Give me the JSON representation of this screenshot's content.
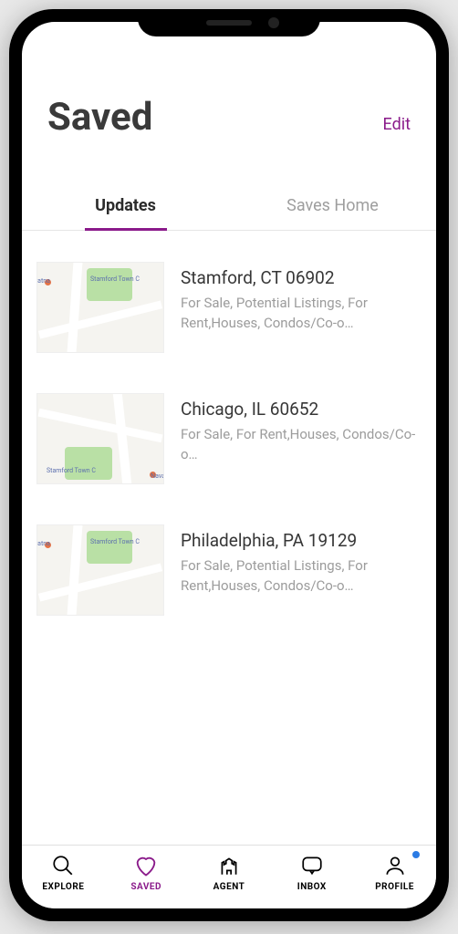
{
  "header": {
    "title": "Saved",
    "edit_label": "Edit"
  },
  "tabs": {
    "updates": "Updates",
    "saves_home": "Saves Home",
    "active": "updates"
  },
  "items": [
    {
      "title": "Stamford, CT 06902",
      "subtitle": "For Sale, Potential Listings, For Rent,Houses, Condos/Co-o…",
      "map_label_a": "Navaratna",
      "map_label_b": "Stamford Town C"
    },
    {
      "title": "Chicago, IL 60652",
      "subtitle": "For Sale, For Rent,Houses, Condos/Co-o…",
      "map_label_a": "Navaratna",
      "map_label_b": "Stamford Town C"
    },
    {
      "title": "Philadelphia, PA 19129",
      "subtitle": "For Sale, Potential Listings, For Rent,Houses, Condos/Co-o…",
      "map_label_a": "Navaratna",
      "map_label_b": "Stamford Town C"
    }
  ],
  "nav": {
    "explore": "EXPLORE",
    "saved": "SAVED",
    "agent": "AGENT",
    "inbox": "INBOX",
    "profile": "PROFILE",
    "active": "saved",
    "profile_has_dot": true
  },
  "colors": {
    "accent": "#8a1a8a",
    "text": "#3a3a3a",
    "muted": "#9c9c9c"
  }
}
